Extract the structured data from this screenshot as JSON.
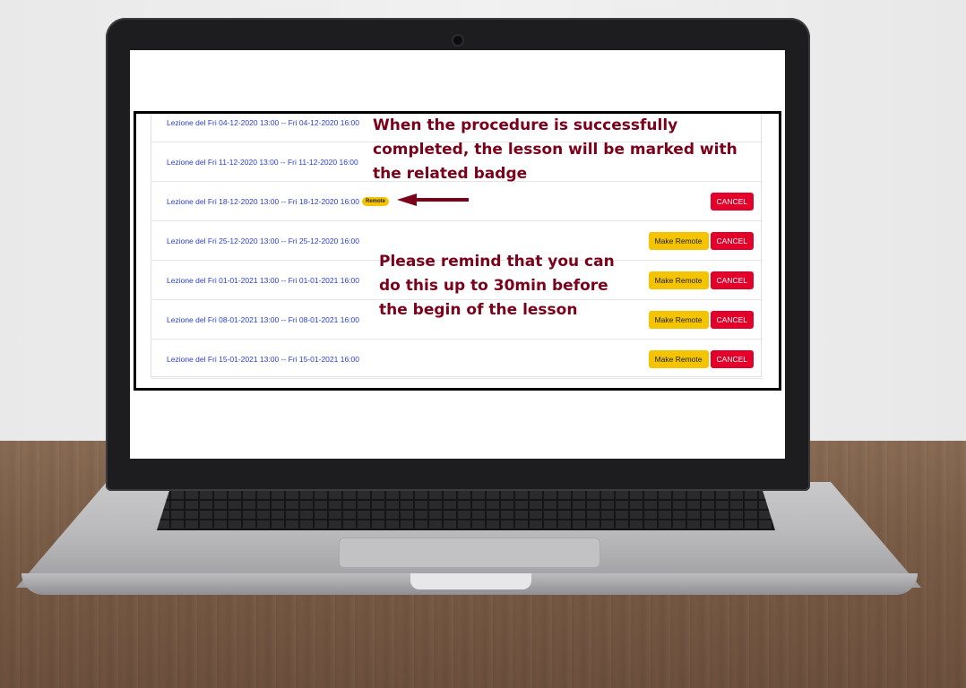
{
  "lessons": [
    {
      "label": "Lezione del Fri 04-12-2020 13:00 -- Fri 04-12-2020 16:00",
      "badge": null,
      "buttons": []
    },
    {
      "label": "Lezione del Fri 11-12-2020 13:00 -- Fri 11-12-2020 16:00",
      "badge": null,
      "buttons": []
    },
    {
      "label": "Lezione del Fri 18-12-2020 13:00 -- Fri 18-12-2020 16:00",
      "badge": "Remote",
      "buttons": [
        "CANCEL"
      ]
    },
    {
      "label": "Lezione del Fri 25-12-2020 13:00 -- Fri 25-12-2020 16:00",
      "badge": null,
      "buttons": [
        "Make Remote",
        "CANCEL"
      ]
    },
    {
      "label": "Lezione del Fri 01-01-2021 13:00 -- Fri 01-01-2021 16:00",
      "badge": null,
      "buttons": [
        "Make Remote",
        "CANCEL"
      ]
    },
    {
      "label": "Lezione del Fri 08-01-2021 13:00 -- Fri 08-01-2021 16:00",
      "badge": null,
      "buttons": [
        "Make Remote",
        "CANCEL"
      ]
    },
    {
      "label": "Lezione del Fri 15-01-2021 13:00 -- Fri 15-01-2021 16:00",
      "badge": null,
      "buttons": [
        "Make Remote",
        "CANCEL"
      ]
    }
  ],
  "annotations": {
    "top_note": [
      "When the procedure is successfully",
      "completed, the lesson will be marked with",
      "the related badge"
    ],
    "bottom_note": [
      "Please remind that you can",
      "do this up to 30min before",
      "the begin of the lesson"
    ]
  },
  "colors": {
    "link": "#2a3fd0",
    "make_remote": "#f5c400",
    "cancel": "#e2002a",
    "annotation": "#7b0019"
  }
}
